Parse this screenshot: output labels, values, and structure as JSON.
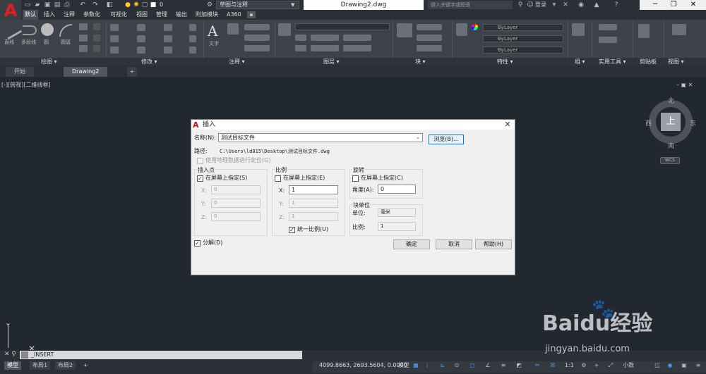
{
  "titlebar": {
    "workspace": "草图与注释",
    "layer_quick": "0",
    "document_title": "Drawing2.dwg",
    "search_placeholder": "键入关键字或短语",
    "login": "登录"
  },
  "menu_tabs": [
    "默认",
    "插入",
    "注释",
    "参数化",
    "可视化",
    "视图",
    "管理",
    "输出",
    "附加模块",
    "A360"
  ],
  "ribbon": {
    "panels": [
      "绘图 ▾",
      "修改 ▾",
      "注释 ▾",
      "图层 ▾",
      "块 ▾",
      "特性 ▾",
      "组 ▾",
      "实用工具 ▾",
      "剪贴板",
      "视图 ▾"
    ],
    "draw_tools": [
      "直线",
      "多段线",
      "圆",
      "圆弧"
    ],
    "annotation_tool": "文字",
    "bylayer": [
      "ByLayer",
      "ByLayer",
      "ByLayer"
    ]
  },
  "file_tabs": [
    "开始",
    "Drawing2",
    "+"
  ],
  "viewport_label": "[-][俯视][二维线框]",
  "viewcube": {
    "north": "北",
    "south": "南",
    "east": "东",
    "west": "西",
    "face": "上",
    "wcs": "WCS"
  },
  "dialog": {
    "title": "插入",
    "name_label": "名称(N):",
    "name_value": "测试目标文件",
    "browse_button": "浏览(B)...",
    "path_label": "路径:",
    "path_value": "C:\\Users\\ld815\\Desktop\\测试目标文件.dwg",
    "geo_checkbox": "使用地理数据进行定位(G)",
    "insertion": {
      "title": "插入点",
      "specify": "在屏幕上指定(S)",
      "x_label": "X:",
      "x_value": "0",
      "y_label": "Y:",
      "y_value": "0",
      "z_label": "Z:",
      "z_value": "0"
    },
    "scale": {
      "title": "比例",
      "specify": "在屏幕上指定(E)",
      "x_label": "X:",
      "x_value": "1",
      "y_label": "Y:",
      "y_value": "1",
      "z_label": "Z:",
      "z_value": "1",
      "uniform": "统一比例(U)"
    },
    "rotation": {
      "title": "旋转",
      "specify": "在屏幕上指定(C)",
      "angle_label": "角度(A):",
      "angle_value": "0"
    },
    "block_unit": {
      "title": "块单位",
      "unit_label": "单位:",
      "unit_value": "毫米",
      "factor_label": "比例:",
      "factor_value": "1"
    },
    "explode": "分解(D)",
    "ok": "确定",
    "cancel": "取消",
    "help": "帮助(H)"
  },
  "y_axis_label": "Y",
  "command_line": "_INSERT",
  "status": {
    "tabs": [
      "模型",
      "布局1",
      "布局2",
      "+"
    ],
    "coordinates": "4099.8663, 2693.5604, 0.0000",
    "model": "模型",
    "scale": "1:1",
    "units": "小数"
  },
  "watermark": {
    "big": "Baidu经验",
    "small": "jingyan.baidu.com"
  }
}
